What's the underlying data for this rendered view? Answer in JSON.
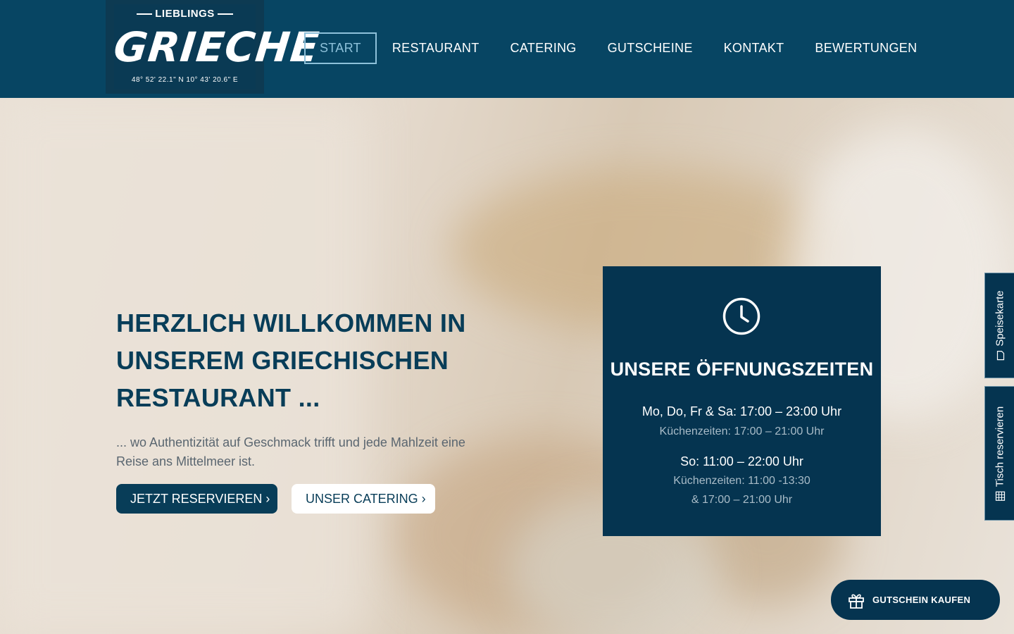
{
  "brand": {
    "logo_top": "LIEBLINGS",
    "logo_main": "GRIECHE",
    "logo_coords": "48° 52' 22.1\" N 10° 43' 20.6\" E"
  },
  "nav": {
    "items": [
      {
        "label": "START",
        "active": true
      },
      {
        "label": "RESTAURANT",
        "active": false
      },
      {
        "label": "CATERING",
        "active": false
      },
      {
        "label": "GUTSCHEINE",
        "active": false
      },
      {
        "label": "KONTAKT",
        "active": false
      },
      {
        "label": "BEWERTUNGEN",
        "active": false
      }
    ]
  },
  "hero": {
    "headline": "HERZLICH WILLKOMMEN IN UNSEREM GRIECHISCHEN RESTAURANT ...",
    "subtext": "... wo Authentizität auf Geschmack trifft und jede Mahlzeit eine Reise ans Mittelmeer ist.",
    "btn_reserve": "JETZT RESERVIEREN ›",
    "btn_catering": "UNSER CATERING ›"
  },
  "hours": {
    "icon": "clock-icon",
    "title": "UNSERE ÖFFNUNGSZEITEN",
    "weekday_hours": "Mo, Do, Fr & Sa: 17:00 – 23:00 Uhr",
    "weekday_kitchen": "Küchenzeiten: 17:00 – 21:00 Uhr",
    "sunday_hours": "So: 11:00 – 22:00 Uhr",
    "sunday_kitchen_1": "Küchenzeiten: 11:00 -13:30",
    "sunday_kitchen_2": "& 17:00 – 21:00 Uhr"
  },
  "side_tabs": {
    "menu": "Speisekarte",
    "reserve": "Tisch reservieren"
  },
  "voucher": {
    "label": "GUTSCHEIN KAUFEN",
    "icon": "gift-icon"
  },
  "colors": {
    "primary": "#074563",
    "dark": "#053450",
    "accent": "#8ec1da",
    "headline": "#083d58"
  }
}
